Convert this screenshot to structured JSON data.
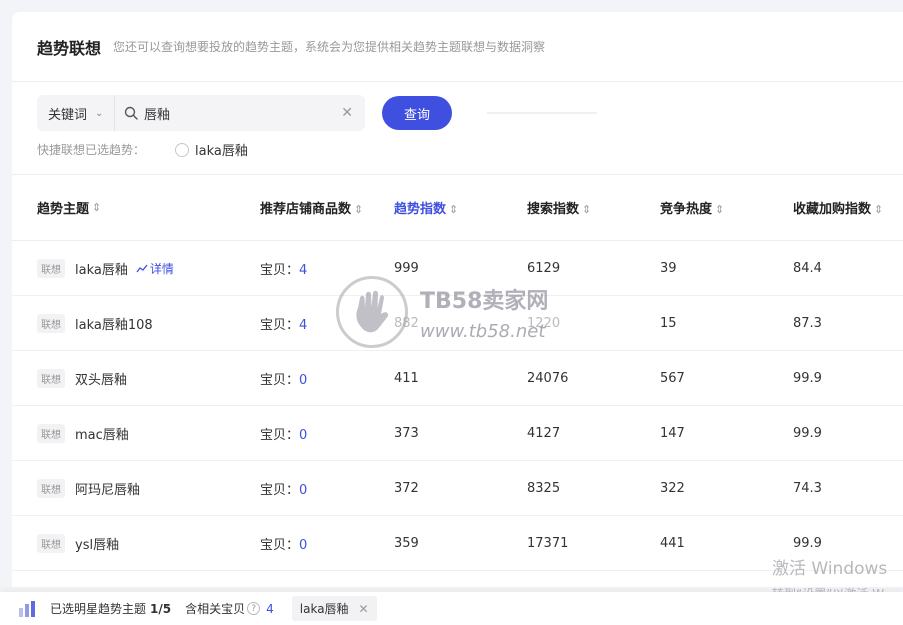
{
  "header": {
    "title": "趋势联想",
    "subtitle": "您还可以查询想要投放的趋势主题，系统会为您提供相关趋势主题联想与数据洞察"
  },
  "search": {
    "type_label": "关键词",
    "query": "唇釉",
    "button_label": "查询"
  },
  "quick": {
    "label": "快捷联想已选趋势：",
    "option": "laka唇釉"
  },
  "table": {
    "columns": [
      "趋势主题",
      "推荐店铺商品数",
      "趋势指数",
      "搜索指数",
      "竞争热度",
      "收藏加购指数"
    ],
    "active_column_index": 2,
    "tag_label": "联想",
    "detail_label": "详情",
    "items_prefix": "宝贝：",
    "rows": [
      {
        "topic": "laka唇釉",
        "items": "4",
        "trend": "999",
        "search": "6129",
        "competition": "39",
        "collect": "84.4"
      },
      {
        "topic": "laka唇釉108",
        "items": "4",
        "trend": "882",
        "search": "1220",
        "competition": "15",
        "collect": "87.3"
      },
      {
        "topic": "双头唇釉",
        "items": "0",
        "trend": "411",
        "search": "24076",
        "competition": "567",
        "collect": "99.9"
      },
      {
        "topic": "mac唇釉",
        "items": "0",
        "trend": "373",
        "search": "4127",
        "competition": "147",
        "collect": "99.9"
      },
      {
        "topic": "阿玛尼唇釉",
        "items": "0",
        "trend": "372",
        "search": "8325",
        "competition": "322",
        "collect": "74.3"
      },
      {
        "topic": "ysl唇釉",
        "items": "0",
        "trend": "359",
        "search": "17371",
        "competition": "441",
        "collect": "99.9"
      }
    ]
  },
  "watermark": {
    "title": "TB58卖家网",
    "url": "www.tb58.net"
  },
  "windows_watermark": {
    "line1": "激活 Windows",
    "line2": "转到“设置”以激活 W"
  },
  "bottom_bar": {
    "selected_label": "已选明星趋势主题",
    "selected_count": "1/5",
    "related_label": "含相关宝贝",
    "related_count": "4",
    "chip_label": "laka唇釉"
  },
  "colors": {
    "accent": "#3f4fe0",
    "background": "#f3f4f7"
  }
}
